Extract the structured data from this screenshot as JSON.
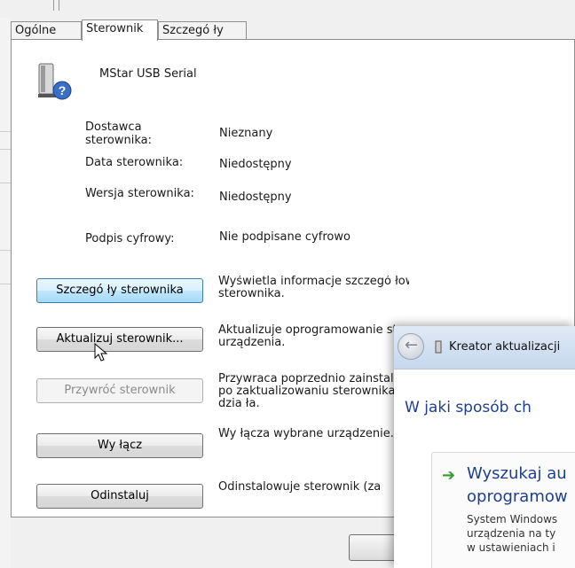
{
  "tabs": [
    {
      "label": "Ogólne"
    },
    {
      "label": "Sterownik"
    },
    {
      "label": "Szczegó ły"
    }
  ],
  "device": {
    "name": "MStar USB Serial",
    "icon": "usb-device-question-icon"
  },
  "properties": {
    "provider_label_line1": "Dostawca",
    "provider_label_line2": "sterownika:",
    "provider_value": "Nieznany",
    "date_label": "Data sterownika:",
    "date_value": "Niedostępny",
    "version_label": "Wersja sterownika:",
    "version_value": "Niedostępny",
    "signer_label": "Podpis cyfrowy:",
    "signer_value": "Nie podpisane cyfrowo"
  },
  "actions": [
    {
      "label": "Szczegó ły sterownika",
      "desc": [
        "Wyświetla informacje szczegó łowe na temat plików",
        "sterownika."
      ]
    },
    {
      "label": "Aktualizuj sterownik...",
      "desc": [
        "Aktualizuje oprogramowanie sterownika dla tego",
        "urządzenia."
      ]
    },
    {
      "label": "Przywróć sterownik",
      "desc": [
        "Przywraca poprzednio zainstalowany sterownik",
        "po zaktualizowaniu sterownika, jeśli urządzenie nie",
        "dzia ła."
      ]
    },
    {
      "label": "Wy łącz",
      "desc": [
        "Wy łącza wybrane urządzenie."
      ]
    },
    {
      "label": "Odinstaluj",
      "desc": [
        "Odinstalowuje sterownik (za"
      ]
    }
  ],
  "wizard": {
    "title": "Kreator aktualizacji",
    "question": "W jaki sposób ch",
    "option_title_line1": "Wyszukaj au",
    "option_title_line2": "oprogramow",
    "option_desc_line1": "System Windows",
    "option_desc_line2": "urządzenia na ty",
    "option_desc_line3": "w ustawieniach i"
  }
}
